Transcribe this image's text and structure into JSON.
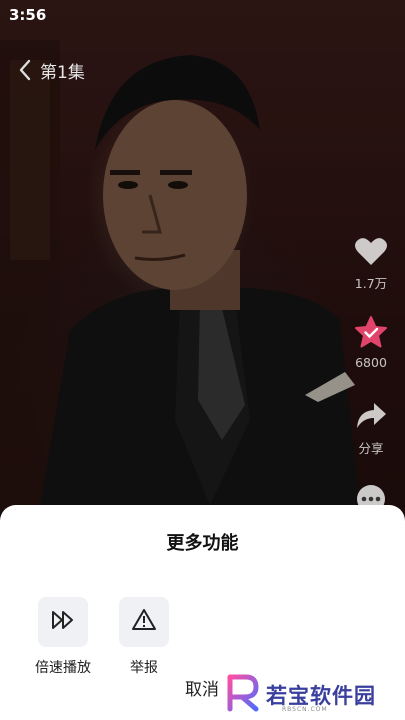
{
  "status_bar": {
    "time": "3:56"
  },
  "header": {
    "episode_title": "第1集"
  },
  "side_actions": {
    "like": {
      "icon": "heart-icon",
      "count": "1.7万"
    },
    "favorite": {
      "icon": "star-icon",
      "count": "6800",
      "color": "#e0446b"
    },
    "share": {
      "icon": "share-icon",
      "label": "分享"
    },
    "more": {
      "icon": "more-icon"
    }
  },
  "sheet": {
    "title": "更多功能",
    "options": [
      {
        "icon": "playback-speed-icon",
        "label": "倍速播放"
      },
      {
        "icon": "report-warning-icon",
        "label": "举报"
      }
    ],
    "cancel_label": "取消"
  },
  "watermark": {
    "text": "若宝软件园",
    "sub": "RBSCN.COM",
    "letter": "R"
  }
}
